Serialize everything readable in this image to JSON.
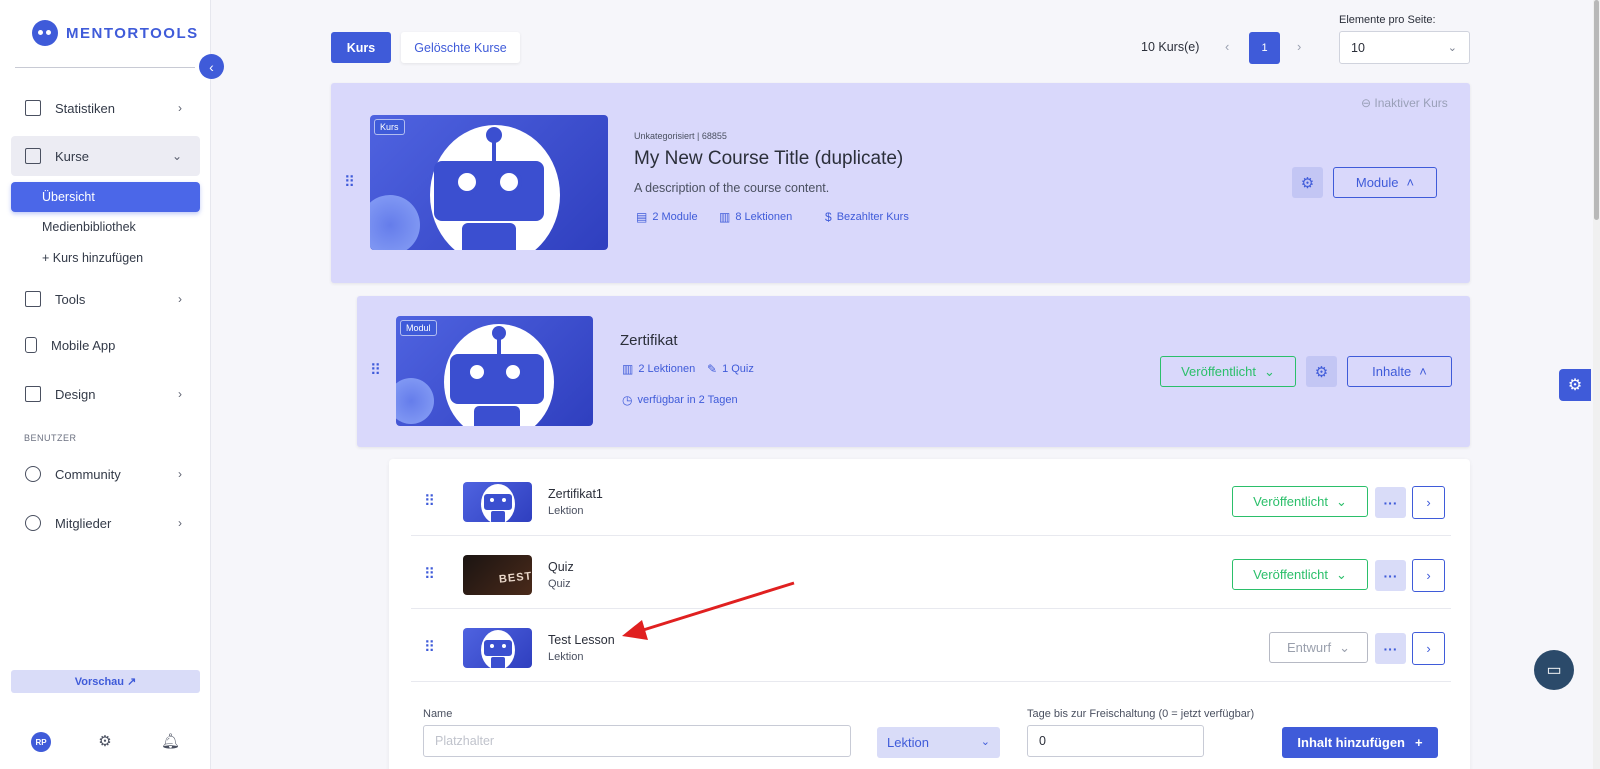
{
  "brand": {
    "name": "MENTORTOOLS",
    "accent": "#3f5bd9"
  },
  "sidebar": {
    "items": [
      {
        "label": "Statistiken",
        "icon": "bar-chart-icon"
      },
      {
        "label": "Kurse",
        "icon": "book-icon"
      },
      {
        "label": "Tools",
        "icon": "megaphone-icon"
      },
      {
        "label": "Mobile App",
        "icon": "phone-icon"
      },
      {
        "label": "Design",
        "icon": "pencil-icon"
      },
      {
        "label": "Community",
        "icon": "people-icon"
      },
      {
        "label": "Mitglieder",
        "icon": "user-icon"
      }
    ],
    "sub_items": [
      "Übersicht",
      "Medienbibliothek",
      "+ Kurs hinzufügen"
    ],
    "section_label": "BENUTZER",
    "preview_label": "Vorschau ↗",
    "avatar_initials": "RP"
  },
  "toolbar": {
    "tab_course": "Kurs",
    "tab_deleted": "Gelöschte Kurse",
    "count": "10 Kurs(e)",
    "current_page": "1",
    "per_page_label": "Elemente pro Seite:",
    "per_page_value": "10"
  },
  "course": {
    "tag": "Kurs",
    "meta": "Unkategorisiert | 68855",
    "title": "My New Course Title (duplicate)",
    "description": "A description of the course content.",
    "modules": "2 Module",
    "lessons": "8 Lektionen",
    "paid": "Bezahlter Kurs",
    "inactive": "Inaktiver Kurs",
    "modules_button": "Module"
  },
  "module": {
    "tag": "Modul",
    "title": "Zertifikat",
    "lessons": "2 Lektionen",
    "quiz": "1 Quiz",
    "availability": "verfügbar in 2 Tagen",
    "status": "Veröffentlicht",
    "content_button": "Inhalte"
  },
  "lessons": [
    {
      "title": "Zertifikat1",
      "type": "Lektion",
      "status": "Veröffentlicht"
    },
    {
      "title": "Quiz",
      "type": "Quiz",
      "status": "Veröffentlicht",
      "thumb_text": "BEST"
    },
    {
      "title": "Test Lesson",
      "type": "Lektion",
      "status": "Entwurf"
    }
  ],
  "form": {
    "name_label": "Name",
    "name_placeholder": "Platzhalter",
    "type_value": "Lektion",
    "days_label": "Tage bis zur Freischaltung (0 = jetzt verfügbar)",
    "days_value": "0",
    "add_button": "Inhalt hinzufügen"
  }
}
